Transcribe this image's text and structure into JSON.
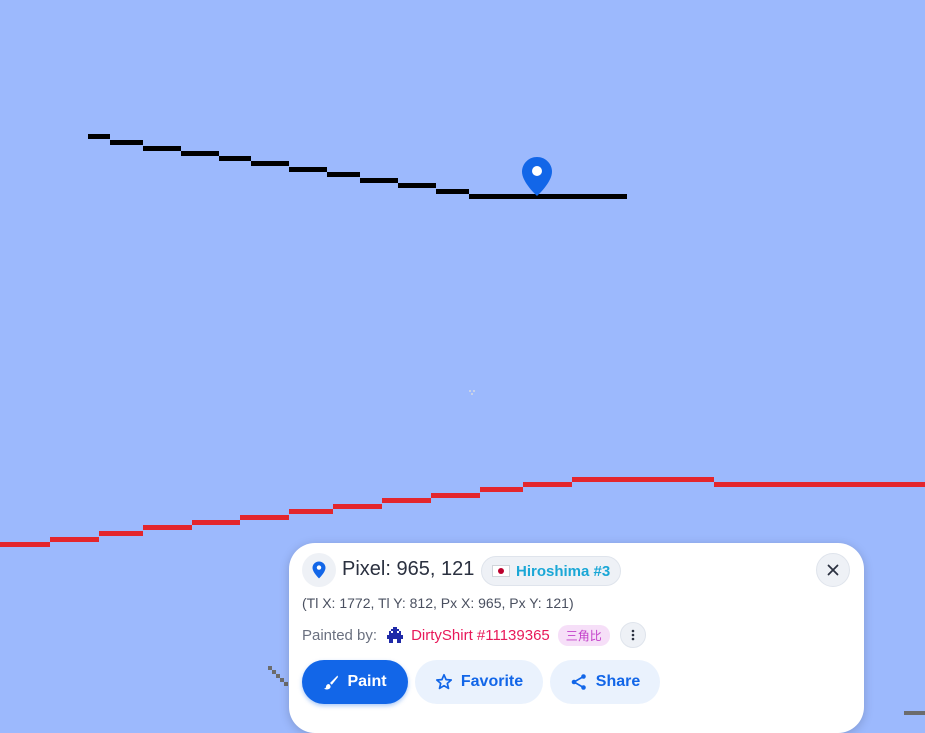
{
  "map": {
    "background_color": "#9cb9fd",
    "line_colors": {
      "black_line": "#000000",
      "red_line": "#e3262d",
      "gray_marks": "#6c6c6c"
    },
    "selected_pixel_marker": "map-pin-icon"
  },
  "pixel_info": {
    "title": "Pixel: 965, 121",
    "region_flag": "japan-flag-icon",
    "region_name": "Hiroshima #3",
    "coords_detail": "(Tl X: 1772, Tl Y: 812, Px X: 965, Px Y: 121)",
    "painted_by_label": "Painted by:",
    "painter_name": "DirtyShirt #11139365",
    "painter_alliance": "三角比",
    "close_icon": "close-icon",
    "more_icon": "more-vertical-icon"
  },
  "actions": {
    "paint_label": "Paint",
    "favorite_label": "Favorite",
    "share_label": "Share"
  },
  "colors": {
    "primary": "#1266e8",
    "region": "#1ba7d6",
    "painter": "#e8195a",
    "alliance": "#c33fc9"
  }
}
